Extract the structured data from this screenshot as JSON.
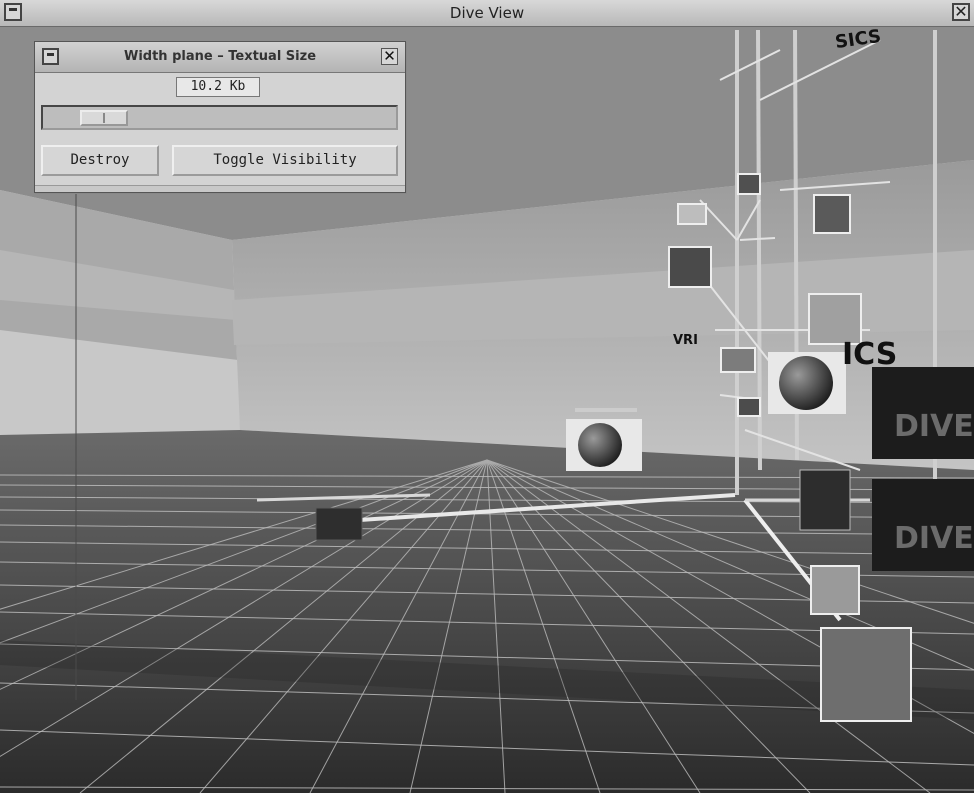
{
  "window": {
    "title": "Dive View",
    "close_glyph": "✕"
  },
  "dialog": {
    "title": "Width plane – Textual Size",
    "close_glyph": "✕",
    "size_value": "10.2 Kb",
    "slider_level": 0.12,
    "destroy_label": "Destroy",
    "toggle_label": "Toggle Visibility"
  },
  "scene": {
    "sign_top": "SICS",
    "sign_mid": "ICS",
    "banner_text_1": "DIVE",
    "banner_text_2": "DIVE",
    "tiny_label": "VRI"
  },
  "icons": [
    "window-menu-icon",
    "close-icon",
    "slider-thumb-icon"
  ]
}
